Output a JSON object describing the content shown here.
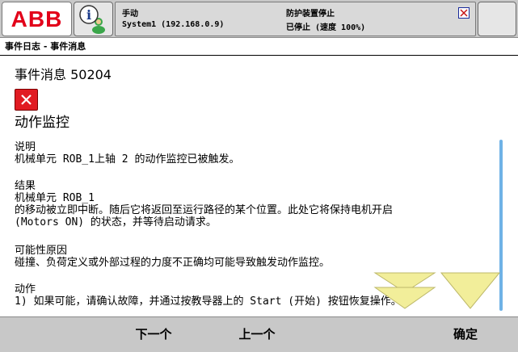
{
  "topbar": {
    "logo_text": "ABB",
    "mode": "手动",
    "system": "System1 (192.168.0.9)",
    "safety_status": "防护装置停止",
    "run_status": "已停止 (速度 100%)"
  },
  "breadcrumb": "事件日志 - 事件消息",
  "event": {
    "title": "事件消息 50204",
    "subject": "动作监控",
    "sections": [
      {
        "heading": "说明",
        "lines": [
          "机械单元 ROB_1上轴 2 的动作监控已被触发。"
        ]
      },
      {
        "heading": "结果",
        "lines": [
          "机械单元 ROB_1",
          "的移动被立即中断。随后它将返回至运行路径的某个位置。此处它将保持电机开启",
          "(Motors ON) 的状态，并等待启动请求。"
        ]
      },
      {
        "heading": "可能性原因",
        "lines": [
          "碰撞、负荷定义或外部过程的力度不正确均可能导致触发动作监控。"
        ]
      },
      {
        "heading": "动作",
        "lines": [
          "1) 如果可能，请确认故障，并通过按教导器上的 Start (开始) 按钮恢复操作。"
        ]
      }
    ]
  },
  "buttons": {
    "next": "下一个",
    "previous": "上一个",
    "ok": "确定"
  },
  "colors": {
    "logo_red": "#e2001a",
    "error_red": "#e11b22",
    "scrollbar_blue": "#6fb2e6",
    "arrow_yellow": "#f2ee9a"
  },
  "icons": {
    "info": "info-person-icon",
    "error": "error-x-icon",
    "window_close": "window-close-icon",
    "scroll": "scroll-down-arrows-icon"
  }
}
